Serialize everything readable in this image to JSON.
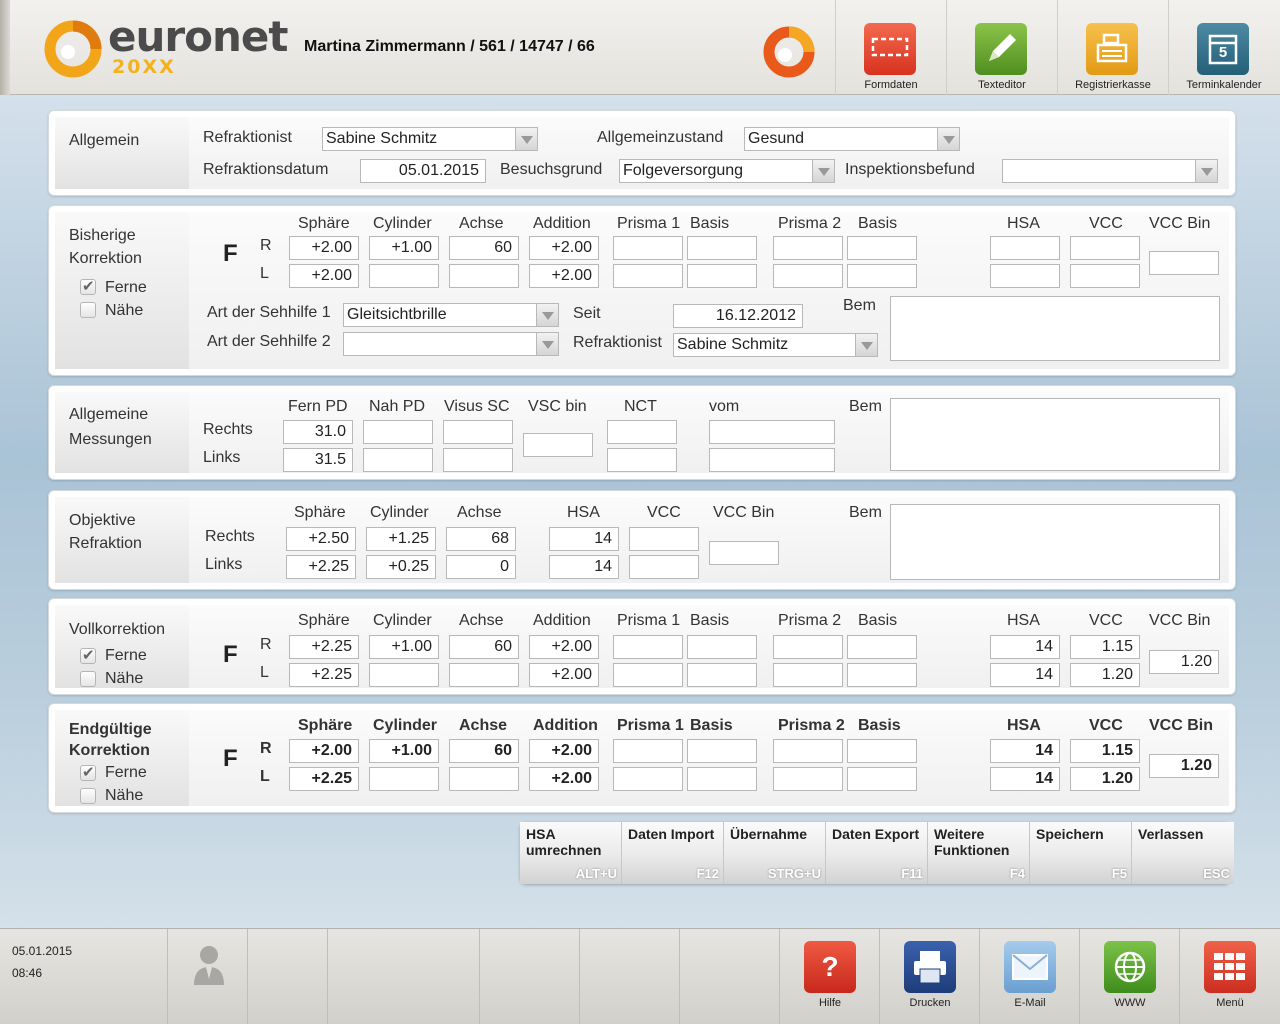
{
  "header": {
    "logo_main": "euronet",
    "logo_sub": "20XX",
    "patient": "Martina Zimmermann / 561 / 14747 / 66",
    "buttons": [
      {
        "label": "Formdaten"
      },
      {
        "label": "Texteditor"
      },
      {
        "label": "Registrierkasse"
      },
      {
        "label": "Terminkalender",
        "day": "5"
      }
    ]
  },
  "allgemein": {
    "title": "Allgemein",
    "refraktionist_label": "Refraktionist",
    "refraktionist": "Sabine Schmitz",
    "zustand_label": "Allgemeinzustand",
    "zustand": "Gesund",
    "datum_label": "Refraktionsdatum",
    "datum": "05.01.2015",
    "grund_label": "Besuchsgrund",
    "grund": "Folgeversorgung",
    "befund_label": "Inspektionsbefund",
    "befund": ""
  },
  "bisherige": {
    "title1": "Bisherige",
    "title2": "Korrektion",
    "ferne": "Ferne",
    "naehe": "Nähe",
    "cols": [
      "Sphäre",
      "Cylinder",
      "Achse",
      "Addition",
      "Prisma 1",
      "Basis",
      "Prisma 2",
      "Basis",
      "HSA",
      "VCC",
      "VCC Bin"
    ],
    "F": "F",
    "R": "R",
    "L": "L",
    "r": [
      "+2.00",
      "+1.00",
      "60",
      "+2.00",
      "",
      "",
      "",
      "",
      "",
      ""
    ],
    "l": [
      "+2.00",
      "",
      "",
      "+2.00",
      "",
      "",
      "",
      "",
      "",
      ""
    ],
    "vccbin": "",
    "art1_label": "Art der Sehhilfe 1",
    "art1": "Gleitsichtbrille",
    "art2_label": "Art der Sehhilfe 2",
    "art2": "",
    "seit_label": "Seit",
    "seit": "16.12.2012",
    "ref_label": "Refraktionist",
    "ref": "Sabine Schmitz",
    "bem_label": "Bem"
  },
  "messungen": {
    "title1": "Allgemeine",
    "title2": "Messungen",
    "cols": [
      "Fern PD",
      "Nah PD",
      "Visus SC",
      "VSC bin",
      "NCT",
      "vom"
    ],
    "rechts": "Rechts",
    "links": "Links",
    "r": [
      "31.0",
      "",
      ""
    ],
    "l": [
      "31.5",
      "",
      ""
    ],
    "vscbin": "",
    "nct_r": "",
    "nct_l": "",
    "vom_r": "",
    "vom_l": "",
    "bem_label": "Bem"
  },
  "objektive": {
    "title1": "Objektive",
    "title2": "Refraktion",
    "cols": [
      "Sphäre",
      "Cylinder",
      "Achse",
      "HSA",
      "VCC",
      "VCC Bin"
    ],
    "rechts": "Rechts",
    "links": "Links",
    "r": [
      "+2.50",
      "+1.25",
      "68",
      "14",
      ""
    ],
    "l": [
      "+2.25",
      "+0.25",
      "0",
      "14",
      ""
    ],
    "vccbin": "",
    "bem_label": "Bem"
  },
  "voll": {
    "title": "Vollkorrektion",
    "ferne": "Ferne",
    "naehe": "Nähe",
    "cols": [
      "Sphäre",
      "Cylinder",
      "Achse",
      "Addition",
      "Prisma 1",
      "Basis",
      "Prisma 2",
      "Basis",
      "HSA",
      "VCC",
      "VCC Bin"
    ],
    "F": "F",
    "R": "R",
    "L": "L",
    "r": [
      "+2.25",
      "+1.00",
      "60",
      "+2.00",
      "",
      "",
      "",
      "",
      "14",
      "1.15"
    ],
    "l": [
      "+2.25",
      "",
      "",
      "+2.00",
      "",
      "",
      "",
      "",
      "14",
      "1.20"
    ],
    "vccbin": "1.20"
  },
  "endg": {
    "title1": "Endgültige",
    "title2": "Korrektion",
    "ferne": "Ferne",
    "naehe": "Nähe",
    "cols": [
      "Sphäre",
      "Cylinder",
      "Achse",
      "Addition",
      "Prisma 1",
      "Basis",
      "Prisma 2",
      "Basis",
      "HSA",
      "VCC",
      "VCC Bin"
    ],
    "F": "F",
    "R": "R",
    "L": "L",
    "r": [
      "+2.00",
      "+1.00",
      "60",
      "+2.00",
      "",
      "",
      "",
      "",
      "14",
      "1.15"
    ],
    "l": [
      "+2.25",
      "",
      "",
      "+2.00",
      "",
      "",
      "",
      "",
      "14",
      "1.20"
    ],
    "vccbin": "1.20"
  },
  "functions": [
    {
      "label": "HSA umrechnen",
      "key": "ALT+U"
    },
    {
      "label": "Daten Import",
      "key": "F12"
    },
    {
      "label": "Übernahme",
      "key": "STRG+U"
    },
    {
      "label": "Daten Export",
      "key": "F11"
    },
    {
      "label": "Weitere Funktionen",
      "key": "F4"
    },
    {
      "label": "Speichern",
      "key": "F5"
    },
    {
      "label": "Verlassen",
      "key": "ESC"
    }
  ],
  "footer": {
    "date": "05.01.2015",
    "time": "08:46",
    "buttons": [
      {
        "label": "Hilfe"
      },
      {
        "label": "Drucken"
      },
      {
        "label": "E-Mail"
      },
      {
        "label": "WWW"
      },
      {
        "label": "Menü"
      }
    ]
  },
  "colors": {
    "brand_orange": "#f3a51a",
    "hilfe": "#d9382b",
    "drucken": "#2b4a8f",
    "email": "#7fb0dc",
    "www": "#5aa42c",
    "menu": "#e0442f"
  }
}
